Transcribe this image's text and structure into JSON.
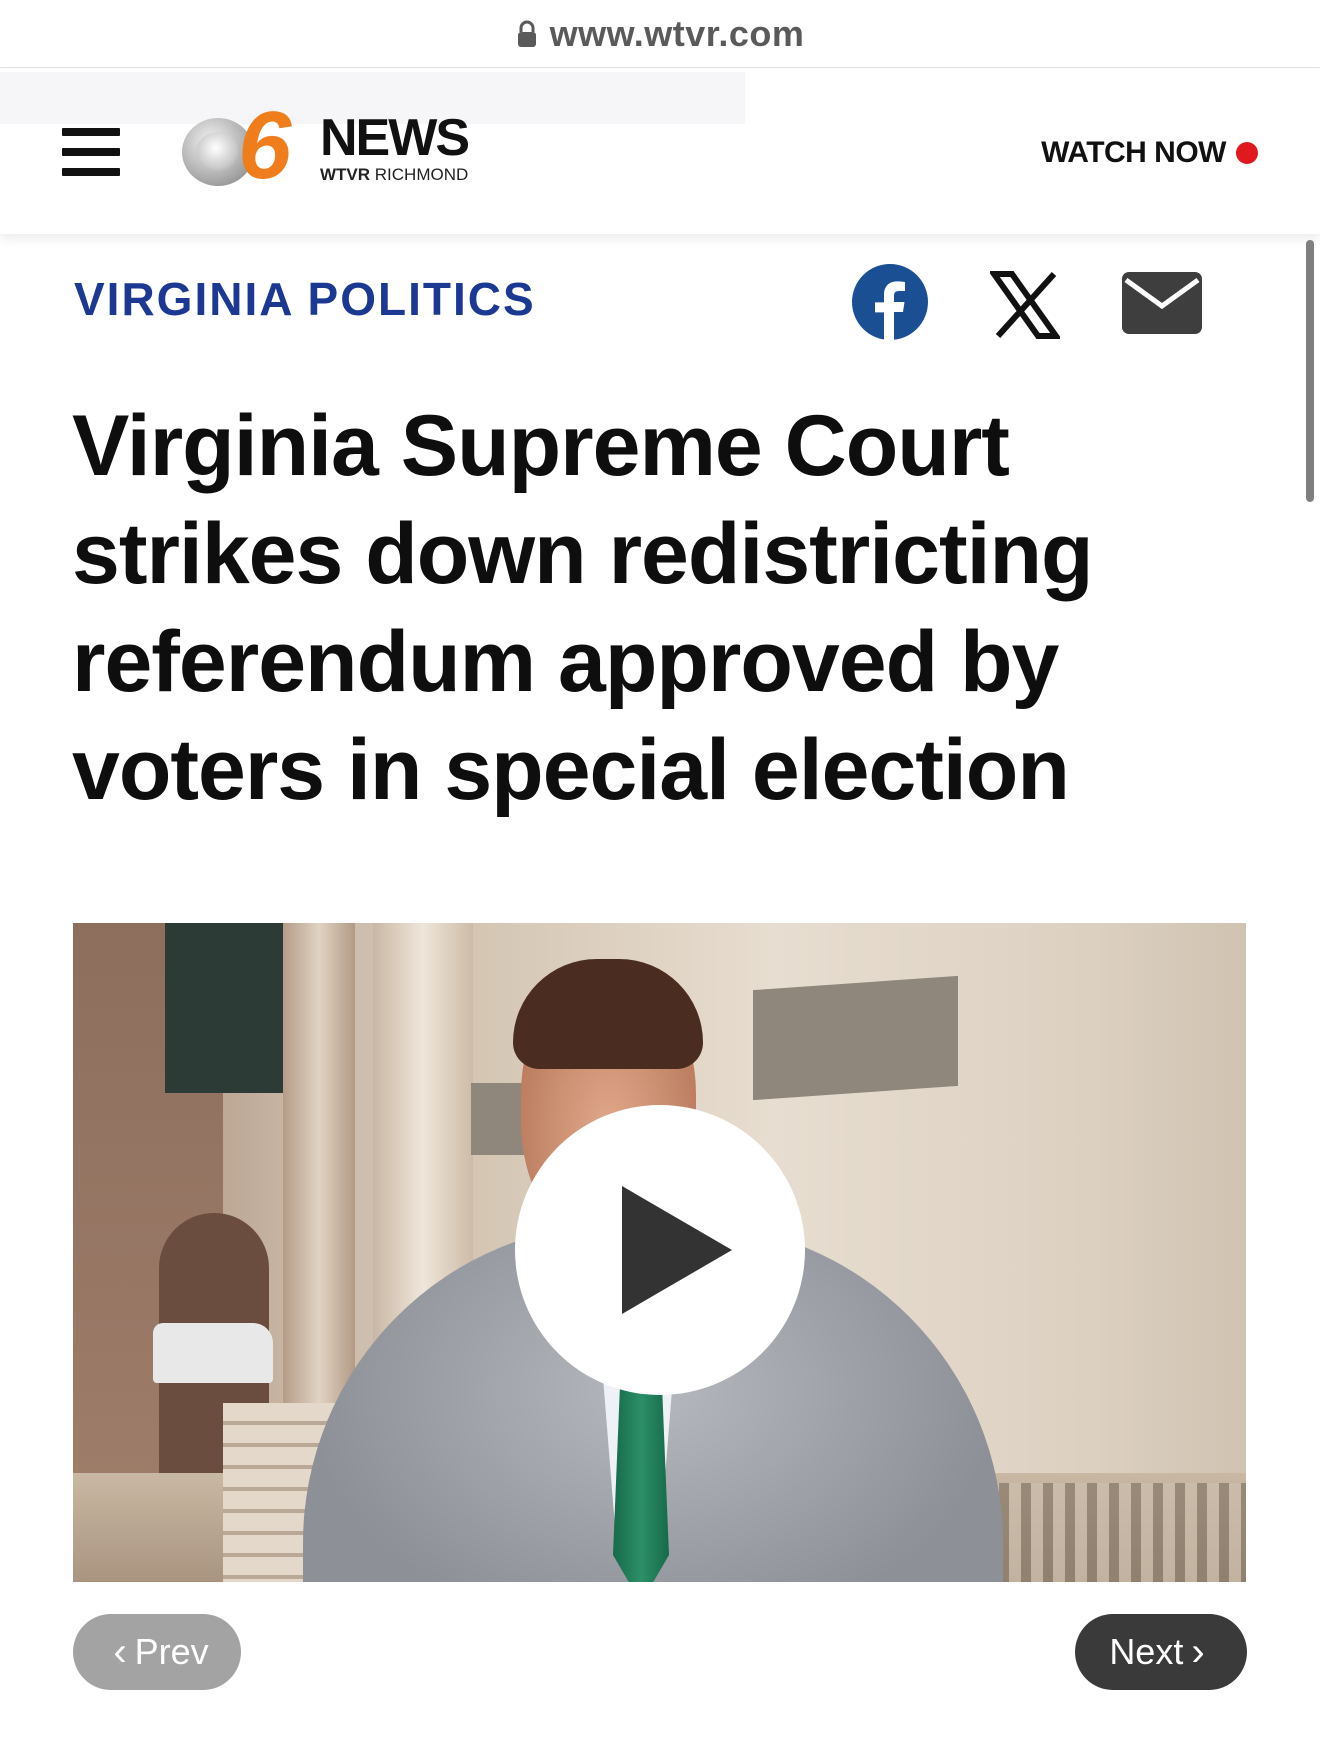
{
  "browser": {
    "url": "www.wtvr.com"
  },
  "header": {
    "logo": {
      "number": "6",
      "news": "NEWS",
      "station": "WTVR",
      "city": "RICHMOND"
    },
    "watch_now_label": "WATCH NOW"
  },
  "article": {
    "section": "VIRGINIA POLITICS",
    "headline": "Virginia Supreme Court strikes down redistricting referendum approved by voters in special election"
  },
  "share_icons": [
    "facebook-icon",
    "x-icon",
    "mail-icon"
  ],
  "pagination": {
    "prev_label": "Prev",
    "next_label": "Next"
  },
  "colors": {
    "section_blue": "#1b3893",
    "live_dot_red": "#e0191e",
    "logo_orange": "#f07d1c",
    "facebook_blue": "#1a4f93"
  }
}
